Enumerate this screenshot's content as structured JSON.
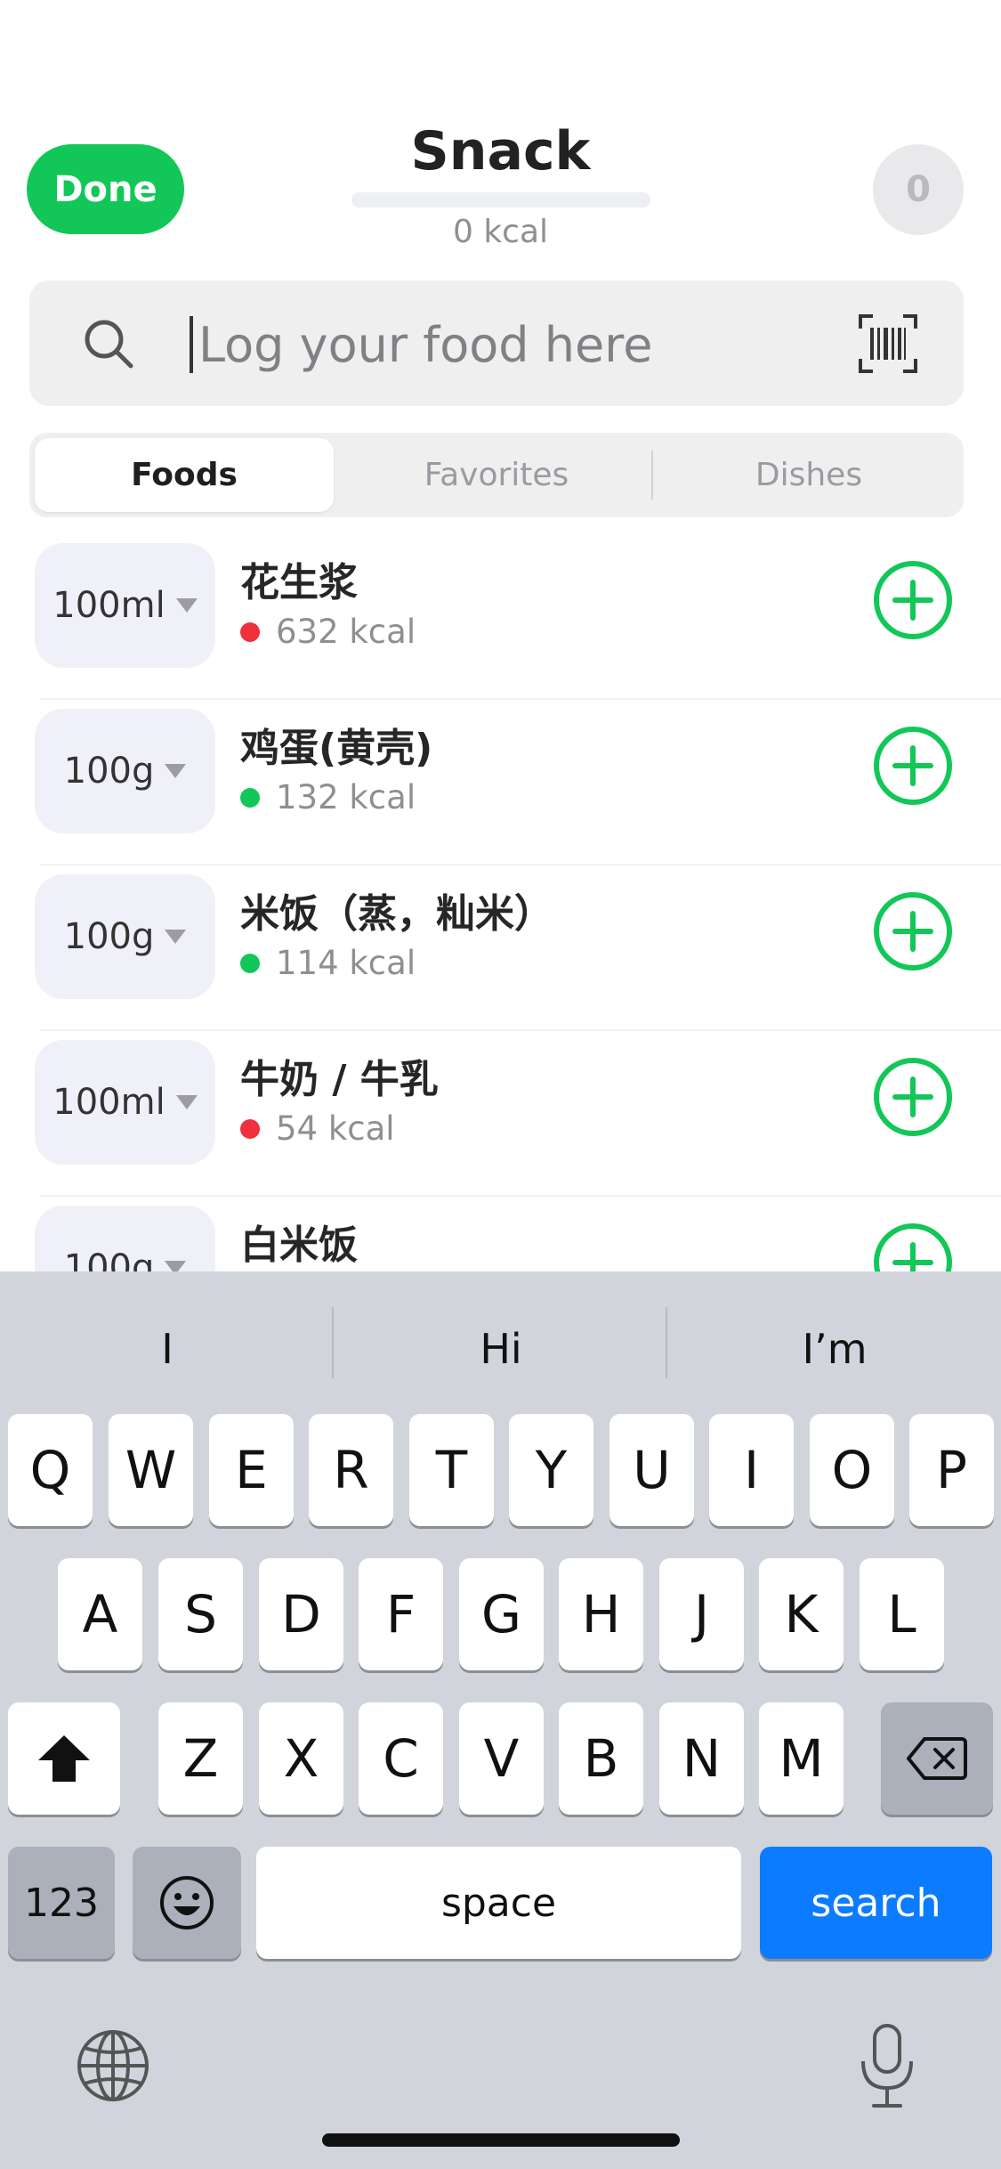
{
  "header": {
    "done_label": "Done",
    "title": "Snack",
    "progress": 0,
    "total_kcal": "0 kcal",
    "count": "0",
    "accent": "#12c758"
  },
  "search": {
    "value": "",
    "placeholder": "Log your food here"
  },
  "tabs": [
    {
      "label": "Foods",
      "active": true
    },
    {
      "label": "Favorites",
      "active": false
    },
    {
      "label": "Dishes",
      "active": false
    }
  ],
  "foods": [
    {
      "unit": "100ml",
      "name": "花生浆",
      "kcal": "632 kcal",
      "indicator": "#f0303d"
    },
    {
      "unit": "100g",
      "name": "鸡蛋(黄壳)",
      "kcal": "132 kcal",
      "indicator": "#12c758"
    },
    {
      "unit": "100g",
      "name": "米饭（蒸，籼米）",
      "kcal": "114 kcal",
      "indicator": "#12c758"
    },
    {
      "unit": "100ml",
      "name": "牛奶 / 牛乳",
      "kcal": "54 kcal",
      "indicator": "#f0303d"
    },
    {
      "unit": "100g",
      "name": "白米饭",
      "kcal": "",
      "indicator": "#12c758"
    }
  ],
  "keyboard": {
    "suggestions": [
      "I",
      "Hi",
      "I’m"
    ],
    "row1": [
      "Q",
      "W",
      "E",
      "R",
      "T",
      "Y",
      "U",
      "I",
      "O",
      "P"
    ],
    "row2": [
      "A",
      "S",
      "D",
      "F",
      "G",
      "H",
      "J",
      "K",
      "L"
    ],
    "row3": [
      "Z",
      "X",
      "C",
      "V",
      "B",
      "N",
      "M"
    ],
    "numbers_label": "123",
    "space_label": "space",
    "search_label": "search",
    "shift_icon": "shift-icon",
    "backspace_icon": "backspace-icon",
    "emoji_icon": "emoji-icon",
    "globe_icon": "globe-icon",
    "mic_icon": "microphone-icon"
  }
}
